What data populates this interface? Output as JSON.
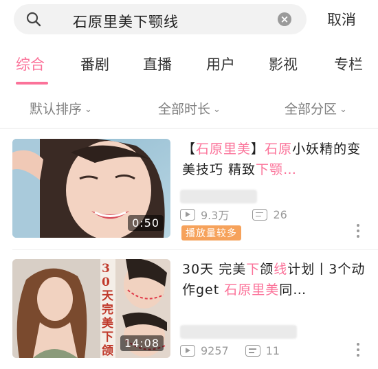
{
  "search": {
    "query": "石原里美下颚线",
    "cancel_label": "取消"
  },
  "tabs": [
    "综合",
    "番剧",
    "直播",
    "用户",
    "影视",
    "专栏"
  ],
  "filters": [
    "默认排序",
    "全部时长",
    "全部分区"
  ],
  "colors": {
    "accent": "#fb7299",
    "badge": "#f6a25b"
  },
  "results": [
    {
      "title_parts": [
        {
          "text": "【",
          "hl": false
        },
        {
          "text": "石原里美",
          "hl": true
        },
        {
          "text": "】",
          "hl": false
        },
        {
          "text": "石原",
          "hl": true
        },
        {
          "text": "小妖精的变美技巧 精致",
          "hl": false
        },
        {
          "text": "下颚…",
          "hl": true
        }
      ],
      "duration": "0:50",
      "views": "9.3万",
      "danmaku": "26",
      "badge": "播放量较多"
    },
    {
      "title_parts": [
        {
          "text": "30天 完美",
          "hl": false
        },
        {
          "text": "下",
          "hl": true
        },
        {
          "text": "颌",
          "hl": false
        },
        {
          "text": "线",
          "hl": true
        },
        {
          "text": "计划丨3个动作get ",
          "hl": false
        },
        {
          "text": "石原里美",
          "hl": true
        },
        {
          "text": "同…",
          "hl": false
        }
      ],
      "duration": "14:08",
      "side_text": "30天完美下颌线",
      "views": "9257",
      "danmaku": "11"
    }
  ]
}
